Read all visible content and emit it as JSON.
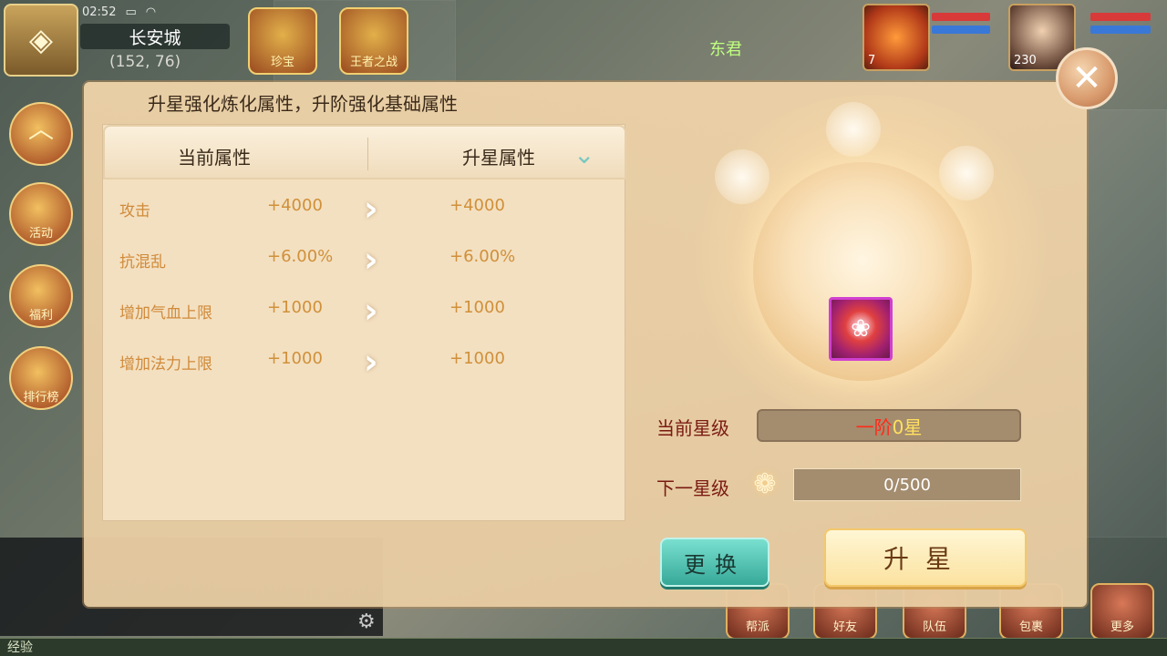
{
  "hud": {
    "time": "02:52",
    "city": "长安城",
    "coords": "(152, 76)",
    "npc_name": "东君",
    "pet_level": "7",
    "hero_level": "230",
    "top_buttons": [
      "珍宝",
      "王者之战"
    ],
    "side_buttons": [
      "活动",
      "福利",
      "排行榜"
    ],
    "bottom_buttons": [
      "帮派",
      "好友",
      "队伍",
      "包裹",
      "更多"
    ],
    "exp_label": "经验"
  },
  "panel": {
    "title": "升星强化炼化属性，升阶强化基础属性",
    "table": {
      "col_current": "当前属性",
      "col_upstar": "升星属性",
      "rows": [
        {
          "name": "攻击",
          "current": "+4000",
          "next": "+4000"
        },
        {
          "name": "抗混乱",
          "current": "+6.00%",
          "next": "+6.00%"
        },
        {
          "name": "增加气血上限",
          "current": "+1000",
          "next": "+1000"
        },
        {
          "name": "增加法力上限",
          "current": "+1000",
          "next": "+1000"
        }
      ]
    },
    "star": {
      "current_label": "当前星级",
      "tier_text": "一阶",
      "star_text": "0星",
      "next_label": "下一星级",
      "progress_text": "0/500",
      "progress_fraction": 0
    },
    "buttons": {
      "change": "更换",
      "upstar": "升星"
    },
    "close_glyph": "✕"
  },
  "colors": {
    "panel_bg": "#eed2a8",
    "value_text": "#d0903a",
    "label_text": "#7a1a12",
    "tier_red": "#ff2a1a",
    "star_yellow": "#ffe060",
    "button_teal": "#36a898",
    "button_gold": "#fbe2a0"
  }
}
